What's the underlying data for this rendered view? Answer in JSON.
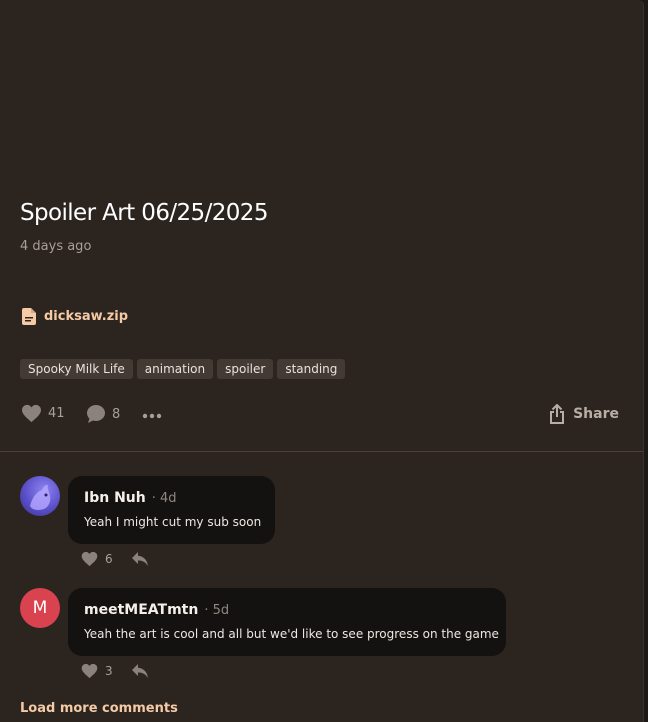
{
  "post": {
    "title": "Spoiler Art 06/25/2025",
    "date": "4 days ago",
    "attachment": {
      "name": "dicksaw.zip",
      "icon": "file-icon"
    },
    "tags": [
      "Spooky Milk Life",
      "animation",
      "spoiler",
      "standing"
    ],
    "likes": "41",
    "comments_count": "8",
    "share_label": "Share"
  },
  "comments": [
    {
      "author": "Ibn Nuh",
      "age": "· 4d",
      "text": "Yeah I might cut my sub soon",
      "likes": "6",
      "avatar_color": "#6b5fd6"
    },
    {
      "author": "meetMEATmtn",
      "age": "· 5d",
      "text": "Yeah the art is cool and all but we'd like to see progress on the game",
      "likes": "3",
      "avatar_letter": "M",
      "avatar_color": "#d9434f"
    }
  ],
  "load_more_label": "Load more comments",
  "colors": {
    "accent": "#f5cba7",
    "background": "#2b241f",
    "bubble": "#141210"
  }
}
